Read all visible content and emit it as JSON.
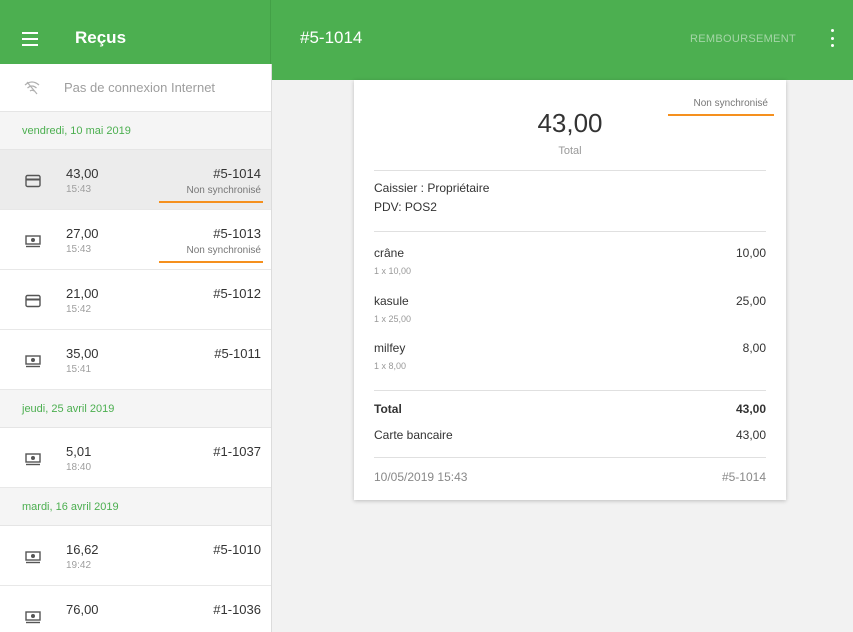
{
  "appbar": {
    "title": "Reçus",
    "receipt_number": "#5-1014",
    "refund_label": "REMBOURSEMENT"
  },
  "sidebar": {
    "offline_text": "Pas de connexion Internet",
    "groups": [
      {
        "date": "vendredi, 10 mai 2019",
        "rows": [
          {
            "amount": "43,00",
            "time": "15:43",
            "number": "#5-1014",
            "sync": "Non synchronisé",
            "icon": "card-icon"
          },
          {
            "amount": "27,00",
            "time": "15:43",
            "number": "#5-1013",
            "sync": "Non synchronisé",
            "icon": "cash-icon"
          },
          {
            "amount": "21,00",
            "time": "15:42",
            "number": "#5-1012",
            "icon": "card-icon"
          },
          {
            "amount": "35,00",
            "time": "15:41",
            "number": "#5-1011",
            "icon": "cash-icon"
          }
        ]
      },
      {
        "date": "jeudi, 25 avril 2019",
        "rows": [
          {
            "amount": "5,01",
            "time": "18:40",
            "number": "#1-1037",
            "icon": "cash-icon"
          }
        ]
      },
      {
        "date": "mardi, 16 avril 2019",
        "rows": [
          {
            "amount": "16,62",
            "time": "19:42",
            "number": "#5-1010",
            "icon": "cash-icon"
          },
          {
            "amount": "76,00",
            "time": "",
            "number": "#1-1036",
            "icon": "cash-icon"
          }
        ]
      }
    ]
  },
  "receipt": {
    "total_big": "43,00",
    "total_label": "Total",
    "sync_status": "Non synchronisé",
    "cashier": "Caissier : Propriétaire",
    "pos": "PDV: POS2",
    "items": [
      {
        "name": "crâne",
        "qty": "1 x 10,00",
        "price": "10,00"
      },
      {
        "name": "kasule",
        "qty": "1 x 25,00",
        "price": "25,00"
      },
      {
        "name": "milfey",
        "qty": "1 x 8,00",
        "price": "8,00"
      }
    ],
    "total_row_label": "Total",
    "total_row_value": "43,00",
    "payment_label": "Carte bancaire",
    "payment_value": "43,00",
    "datetime": "10/05/2019 15:43",
    "footer_number": "#5-1014"
  },
  "colors": {
    "appbar": "#4caf50",
    "accent_green": "#4caf50",
    "underline_orange": "#f5901e"
  }
}
